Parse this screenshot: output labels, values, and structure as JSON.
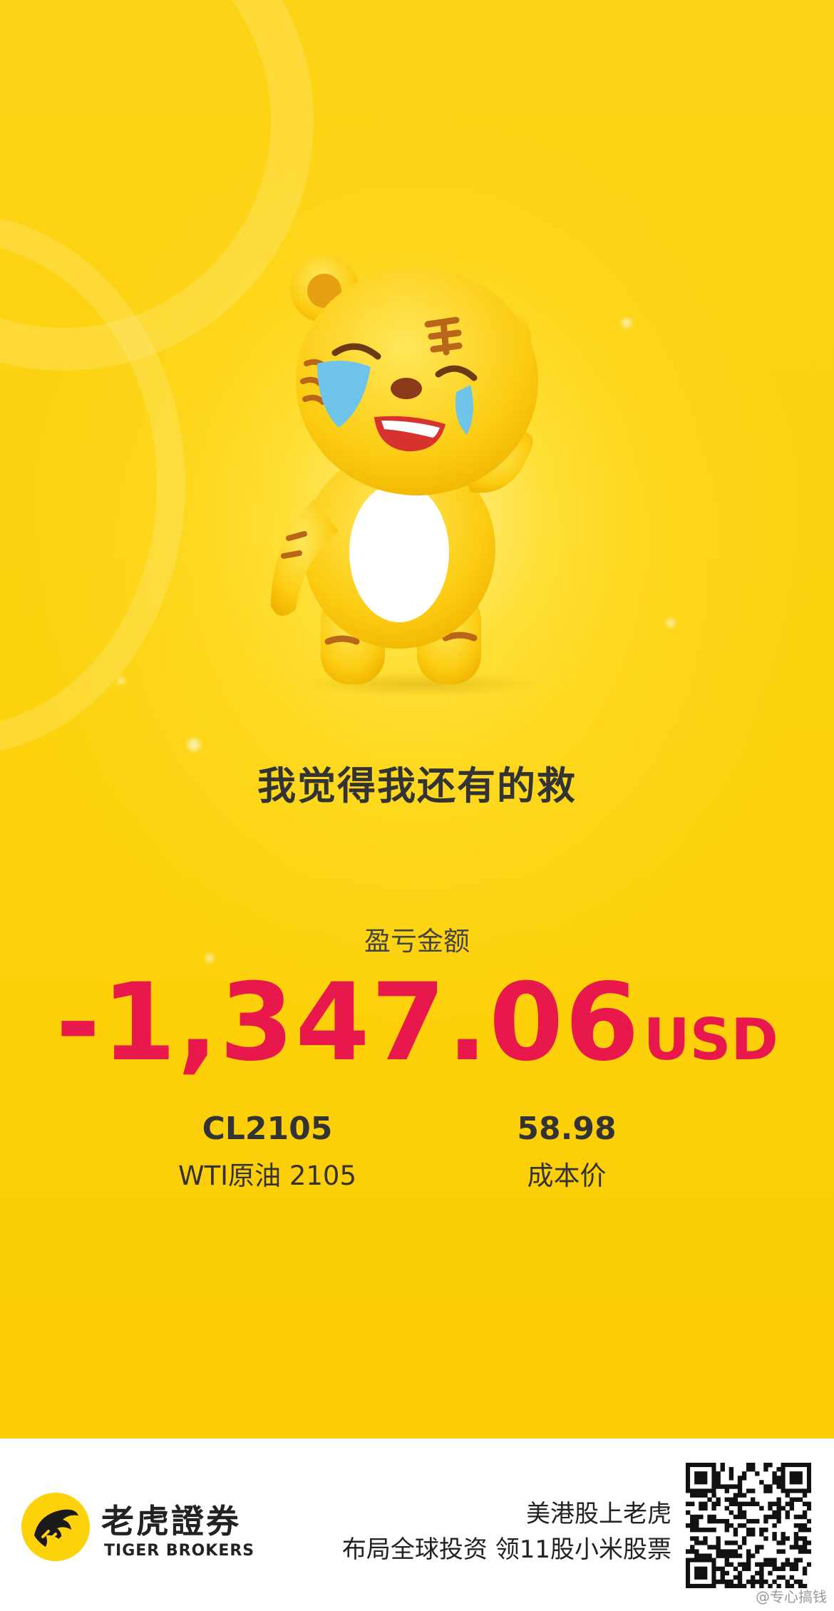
{
  "share_card": {
    "mood_text": "我觉得我还有的救",
    "pl_label": "盈亏金额",
    "pl_amount": "-1,347.06",
    "pl_currency": "USD",
    "symbol": "CL2105",
    "symbol_name": "WTI原油 2105",
    "cost_price": "58.98",
    "cost_price_label": "成本价",
    "amount_color": "#e8174c",
    "background_color": "#fdd20a"
  },
  "footer": {
    "brand_cn": "老虎證券",
    "brand_en": "TIGER BROKERS",
    "slogan_line1": "美港股上老虎",
    "slogan_line2": "布局全球投资 领11股小米股票",
    "qr_icon": "qr-code-icon",
    "watermark": "@专心搞钱"
  },
  "mascot": {
    "icon": "crying-tiger-mascot-icon"
  }
}
